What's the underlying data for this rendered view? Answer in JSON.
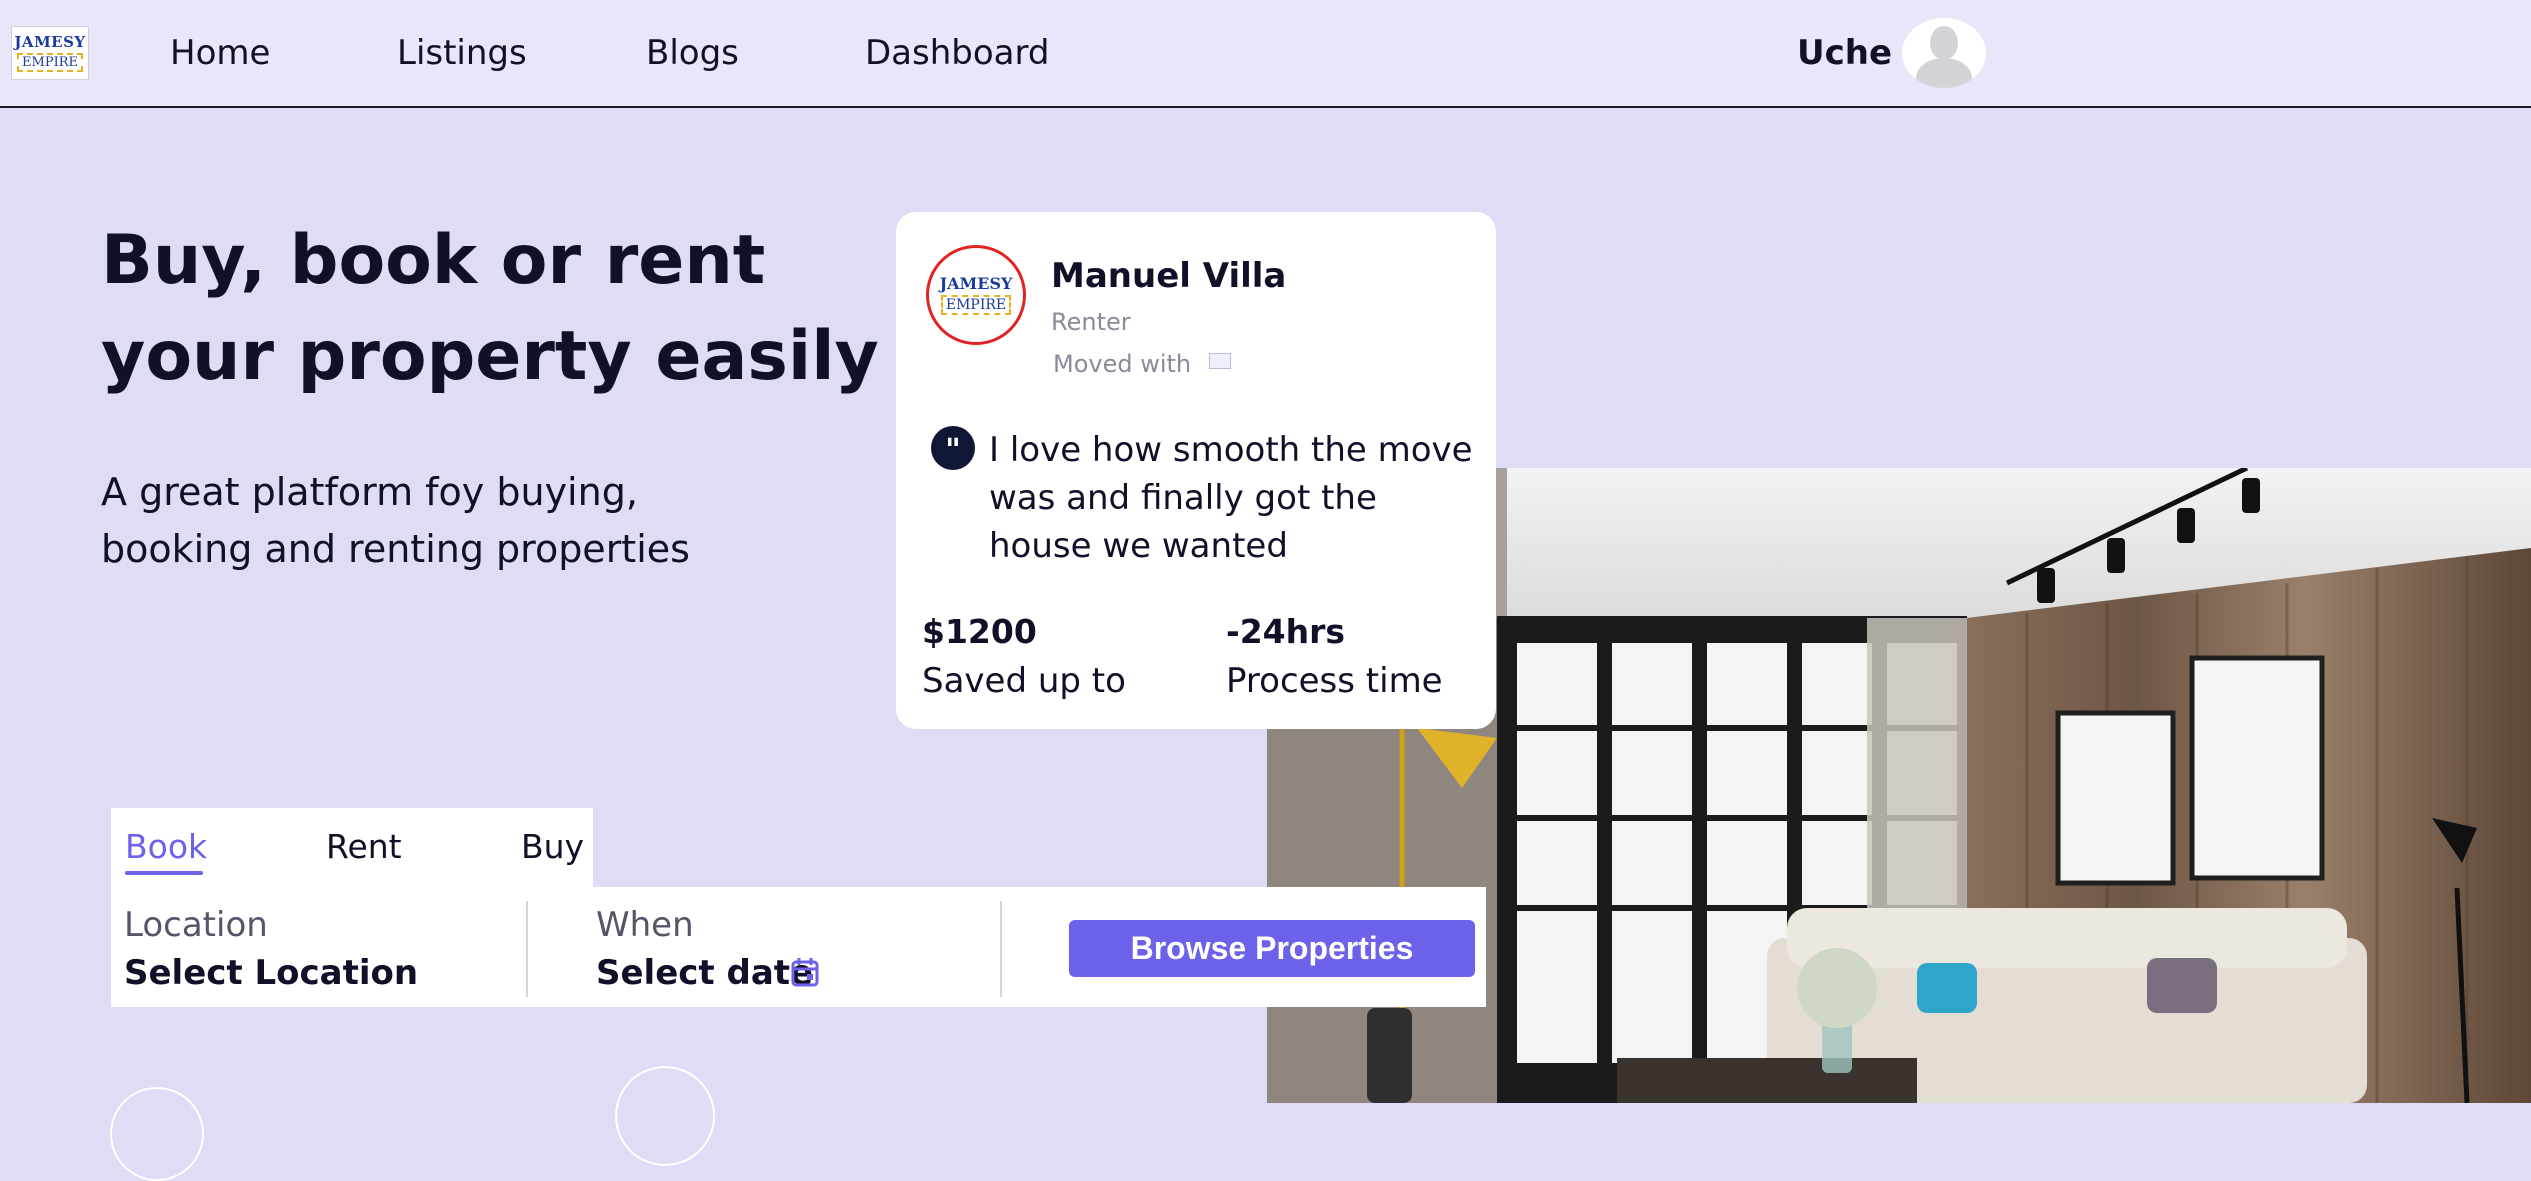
{
  "brand": {
    "logo_line1": "JAMESY",
    "logo_line2": "EMPIRE"
  },
  "nav": {
    "items": [
      {
        "label": "Home"
      },
      {
        "label": "Listings"
      },
      {
        "label": "Blogs"
      },
      {
        "label": "Dashboard"
      }
    ],
    "user_name": "Uche",
    "avatar_icon": "user-avatar-icon"
  },
  "hero": {
    "title": "Buy, book or rent your property easily",
    "subtitle": "A great platform foy buying, booking and renting properties"
  },
  "testimonial": {
    "name": "Manuel Villa",
    "role": "Renter",
    "moved_with": "Moved with",
    "quote": "I love how smooth the move was and finally got the house we wanted",
    "stats": [
      {
        "value": "$1200",
        "label": "Saved up to"
      },
      {
        "value": "-24hrs",
        "label": "Process time"
      }
    ]
  },
  "search": {
    "tabs": [
      {
        "label": "Book",
        "active": true
      },
      {
        "label": "Rent",
        "active": false
      },
      {
        "label": "Buy",
        "active": false
      }
    ],
    "location_label": "Location",
    "location_value": "Select Location",
    "when_label": "When",
    "when_value": "Select date",
    "calendar_icon": "calendar-icon",
    "browse_label": "Browse Properties"
  },
  "colors": {
    "accent": "#6b62e9",
    "page_bg": "#dfdcf5",
    "nav_bg": "#e8e6f8",
    "dark_text": "#101028",
    "quote_icon_bg": "#0f1735"
  }
}
